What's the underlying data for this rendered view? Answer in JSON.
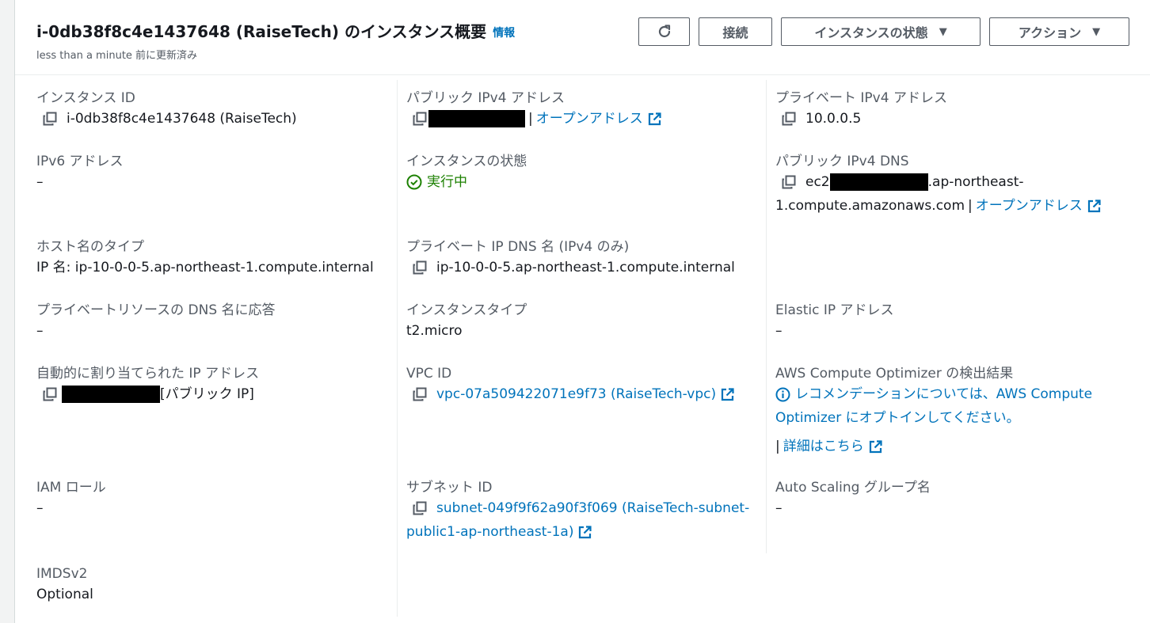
{
  "header": {
    "title": "i-0db38f8c4e1437648 (RaiseTech) のインスタンス概要",
    "info_label": "情報",
    "updated": "less than a minute 前に更新済み",
    "buttons": {
      "refresh": "refresh-icon",
      "connect": "接続",
      "instance_state": "インスタンスの状態",
      "actions": "アクション"
    }
  },
  "fields": {
    "instance_id": {
      "label": "インスタンス ID",
      "value": "i-0db38f8c4e1437648 (RaiseTech)"
    },
    "public_ipv4": {
      "label": "パブリック IPv4 アドレス",
      "link": "オープンアドレス"
    },
    "private_ipv4": {
      "label": "プライベート IPv4 アドレス",
      "value": "10.0.0.5"
    },
    "ipv6": {
      "label": "IPv6 アドレス",
      "value": "–"
    },
    "instance_state": {
      "label": "インスタンスの状態",
      "value": "実行中"
    },
    "public_dns": {
      "label": "パブリック IPv4 DNS",
      "prefix": "ec2",
      "suffix": ".ap-northeast-",
      "line2": "1.compute.amazonaws.com",
      "link": "オープンアドレス"
    },
    "hostname_type": {
      "label": "ホスト名のタイプ",
      "value": "IP 名: ip-10-0-0-5.ap-northeast-1.compute.internal"
    },
    "private_dns": {
      "label": "プライベート IP DNS 名 (IPv4 のみ)",
      "value": "ip-10-0-0-5.ap-northeast-1.compute.internal"
    },
    "private_resource_dns": {
      "label": "プライベートリソースの DNS 名に応答",
      "value": "–"
    },
    "instance_type": {
      "label": "インスタンスタイプ",
      "value": "t2.micro"
    },
    "elastic_ip": {
      "label": "Elastic IP アドレス",
      "value": "–"
    },
    "auto_ip": {
      "label": "自動的に割り当てられた IP アドレス",
      "suffix": "[パブリック IP]"
    },
    "vpc_id": {
      "label": "VPC ID",
      "link": "vpc-07a509422071e9f73 (RaiseTech-vpc)"
    },
    "optimizer": {
      "label": "AWS Compute Optimizer の検出結果",
      "line1": "レコメンデーションについては、AWS Compute",
      "line2": "Optimizer にオプトインしてください。",
      "details": "詳細はこちら"
    },
    "iam_role": {
      "label": "IAM ロール",
      "value": "–"
    },
    "subnet_id": {
      "label": "サブネット ID",
      "line1": "subnet-049f9f62a90f3f069 (RaiseTech-subnet-",
      "line2": "public1-ap-northeast-1a)"
    },
    "asg": {
      "label": "Auto Scaling グループ名",
      "value": "–"
    },
    "imdsv2": {
      "label": "IMDSv2",
      "value": "Optional"
    }
  },
  "colors": {
    "link": "#0073bb",
    "running": "#1d8102",
    "label": "#545b64",
    "text": "#16191f"
  }
}
